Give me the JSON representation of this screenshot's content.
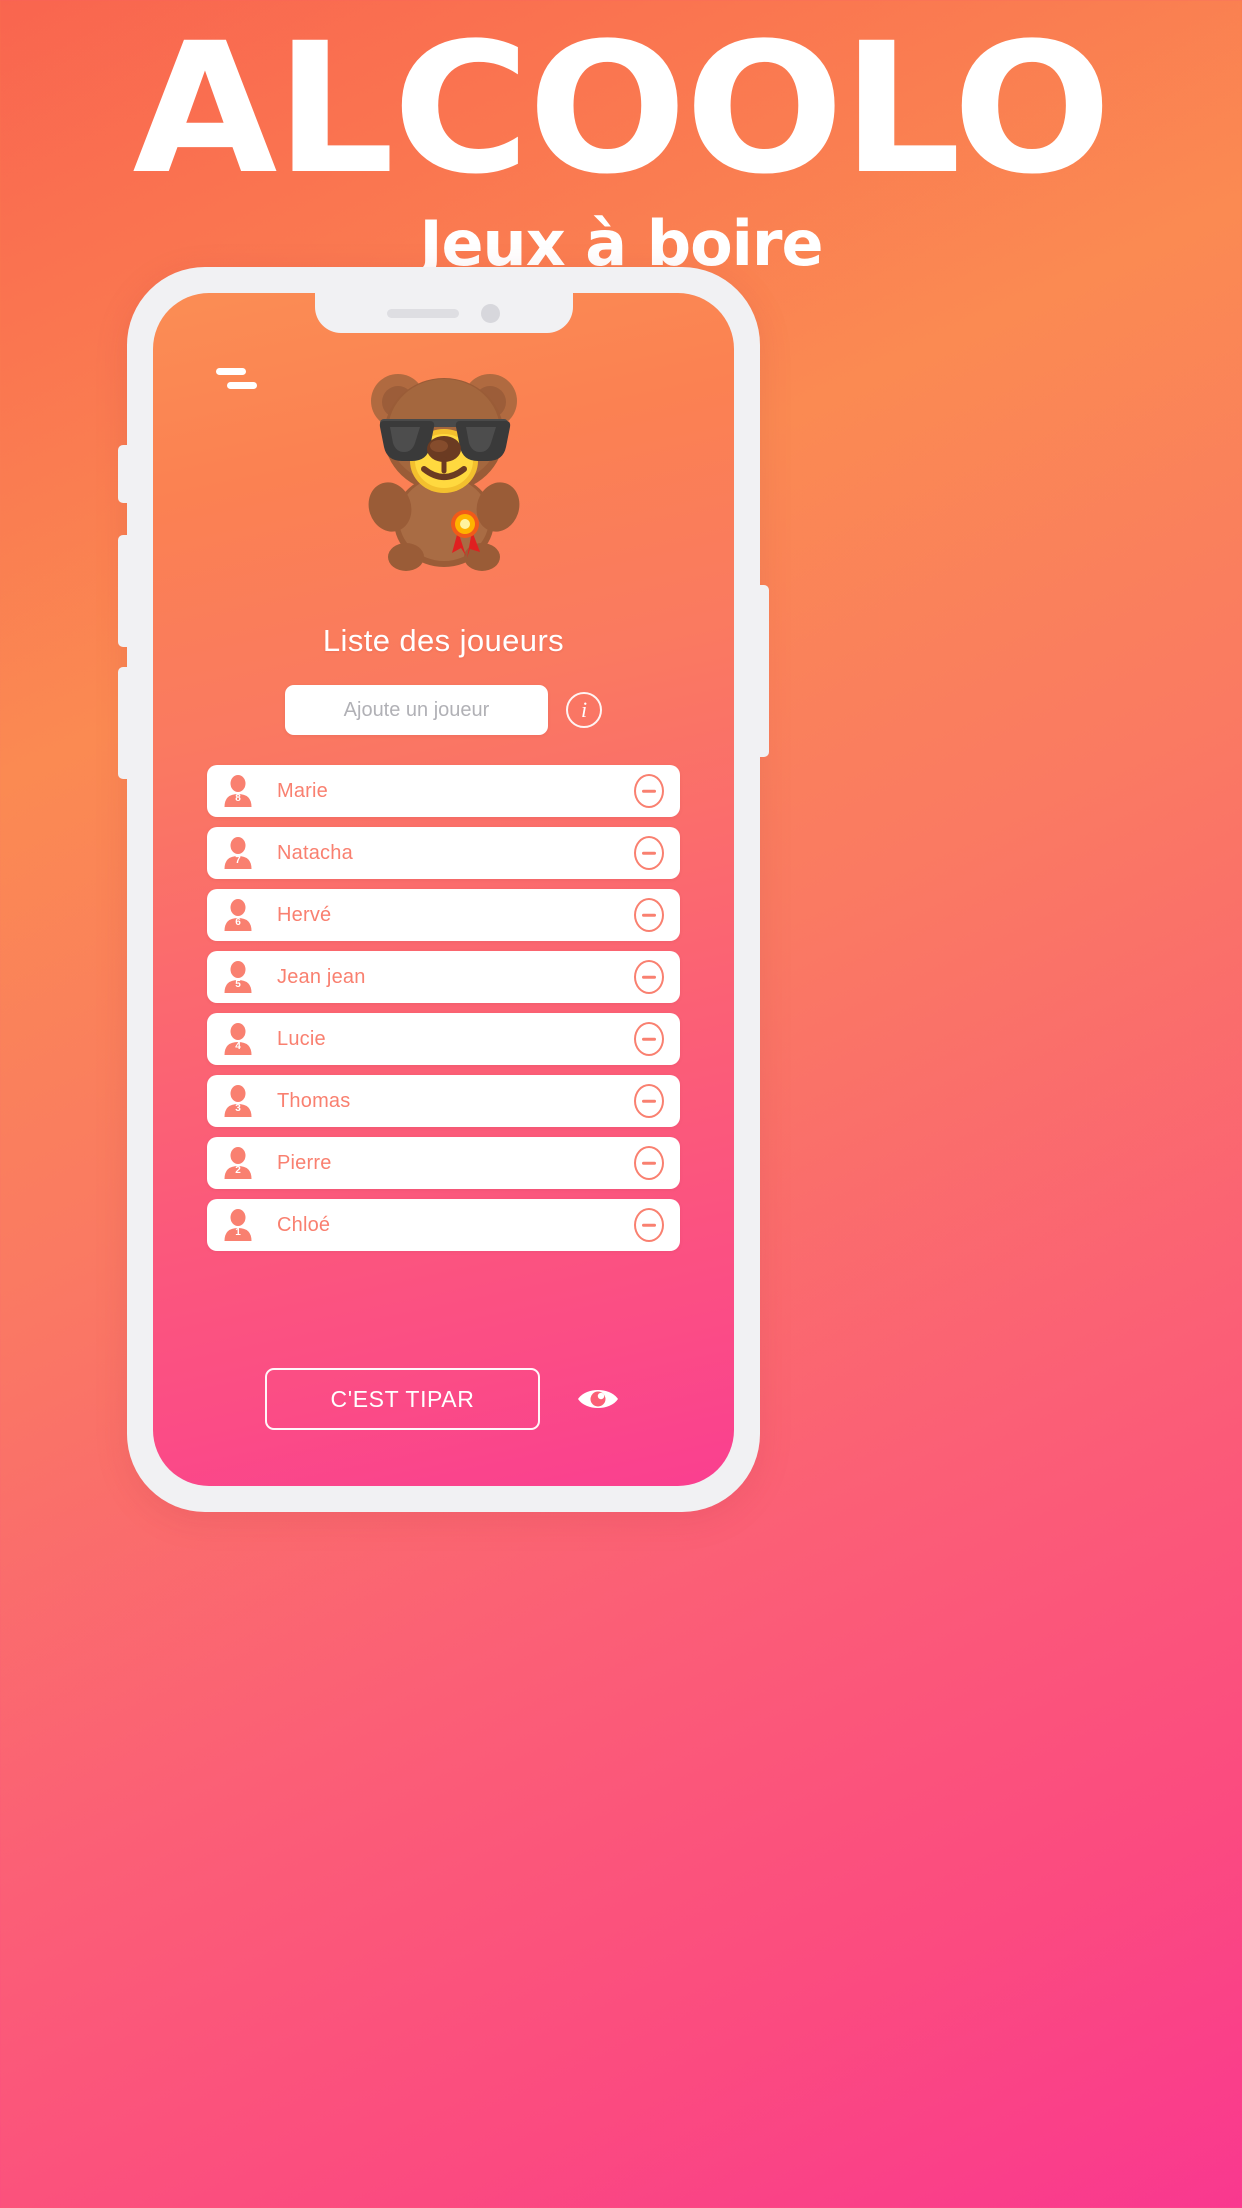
{
  "banner": {
    "title": "ALCOOLO",
    "subtitle": "Jeux à boire"
  },
  "colors": {
    "bg_start": "#f9654f",
    "bg_mid": "#fb8a52",
    "bg_end": "#f9388f",
    "accent": "#f98070",
    "card": "#ffffff",
    "frame": "#f1f1f3"
  },
  "phone": {
    "notch": {
      "speaker": "speaker-bar",
      "camera": "camera-dot"
    },
    "buttons": [
      "mute-switch",
      "volume-up",
      "volume-down",
      "power"
    ]
  },
  "screen": {
    "menu_icon": "hamburger-icon",
    "mascot": "teddy-bear-with-sunglasses",
    "list_title": "Liste des joueurs",
    "add": {
      "placeholder": "Ajoute un joueur",
      "value": "",
      "info_label": "i"
    },
    "players": [
      {
        "number": "8",
        "name": "Marie"
      },
      {
        "number": "7",
        "name": "Natacha"
      },
      {
        "number": "6",
        "name": "Hervé"
      },
      {
        "number": "5",
        "name": "Jean jean"
      },
      {
        "number": "4",
        "name": "Lucie"
      },
      {
        "number": "3",
        "name": "Thomas"
      },
      {
        "number": "2",
        "name": "Pierre"
      },
      {
        "number": "1",
        "name": "Chloé"
      }
    ],
    "footer": {
      "start_label": "C'EST TIPAR",
      "eye_icon": "eye-icon"
    }
  }
}
